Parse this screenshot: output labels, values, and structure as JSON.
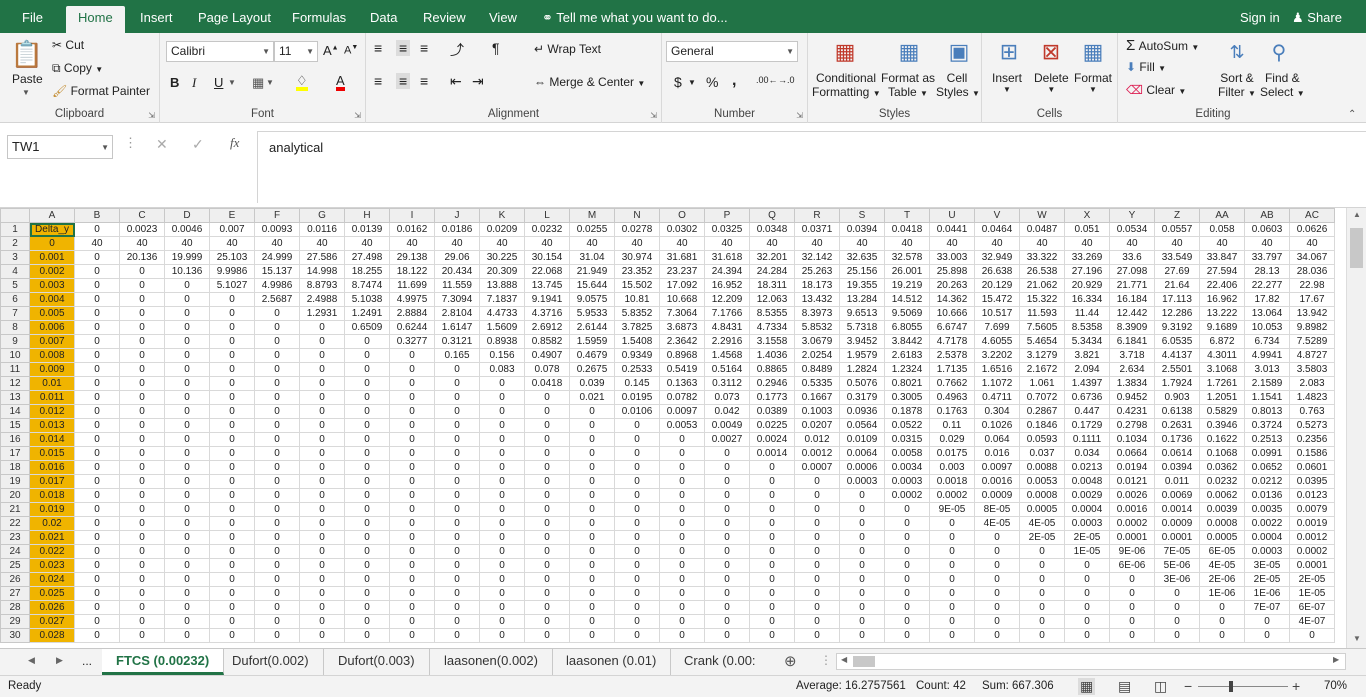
{
  "ribbon_tabs": [
    "File",
    "Home",
    "Insert",
    "Page Layout",
    "Formulas",
    "Data",
    "Review",
    "View"
  ],
  "tell_me": "Tell me what you want to do...",
  "sign_in": "Sign in",
  "share": "Share",
  "clipboard": {
    "paste": "Paste",
    "cut": "Cut",
    "copy": "Copy",
    "format_painter": "Format Painter",
    "label": "Clipboard"
  },
  "font": {
    "name": "Calibri",
    "size": "11",
    "label": "Font",
    "bold": "B",
    "italic": "I",
    "underline": "U"
  },
  "alignment": {
    "wrap_text": "Wrap Text",
    "merge_center": "Merge & Center",
    "label": "Alignment"
  },
  "number": {
    "format": "General",
    "currency": "$",
    "percent": "%",
    "comma": ",",
    "label": "Number"
  },
  "styles": {
    "conditional": "Conditional",
    "formatting": "Formatting",
    "format_as": "Format as",
    "table": "Table",
    "cell": "Cell",
    "cell_styles": "Styles",
    "label": "Styles"
  },
  "cells": {
    "insert": "Insert",
    "delete": "Delete",
    "format": "Format",
    "label": "Cells"
  },
  "editing": {
    "autosum": "AutoSum",
    "fill": "Fill",
    "clear": "Clear",
    "sort": "Sort &",
    "filter": "Filter",
    "find": "Find &",
    "select": "Select",
    "label": "Editing"
  },
  "name_box": "TW1",
  "formula_content": "analytical",
  "fx": "fx",
  "columns": [
    "A",
    "B",
    "C",
    "D",
    "E",
    "F",
    "G",
    "H",
    "I",
    "J",
    "K",
    "L",
    "M",
    "N",
    "O",
    "P",
    "Q",
    "R",
    "S",
    "T",
    "U",
    "V",
    "W",
    "X",
    "Y",
    "Z",
    "AA",
    "AB",
    "AC"
  ],
  "rows": [
    [
      "Delta_y",
      "0",
      "0.0023",
      "0.0046",
      "0.007",
      "0.0093",
      "0.0116",
      "0.0139",
      "0.0162",
      "0.0186",
      "0.0209",
      "0.0232",
      "0.0255",
      "0.0278",
      "0.0302",
      "0.0325",
      "0.0348",
      "0.0371",
      "0.0394",
      "0.0418",
      "0.0441",
      "0.0464",
      "0.0487",
      "0.051",
      "0.0534",
      "0.0557",
      "0.058",
      "0.0603",
      "0.0626"
    ],
    [
      "0",
      "40",
      "40",
      "40",
      "40",
      "40",
      "40",
      "40",
      "40",
      "40",
      "40",
      "40",
      "40",
      "40",
      "40",
      "40",
      "40",
      "40",
      "40",
      "40",
      "40",
      "40",
      "40",
      "40",
      "40",
      "40",
      "40",
      "40",
      "40"
    ],
    [
      "0.001",
      "0",
      "20.136",
      "19.999",
      "25.103",
      "24.999",
      "27.586",
      "27.498",
      "29.138",
      "29.06",
      "30.225",
      "30.154",
      "31.04",
      "30.974",
      "31.681",
      "31.618",
      "32.201",
      "32.142",
      "32.635",
      "32.578",
      "33.003",
      "32.949",
      "33.322",
      "33.269",
      "33.6",
      "33.549",
      "33.847",
      "33.797",
      "34.067"
    ],
    [
      "0.002",
      "0",
      "0",
      "10.136",
      "9.9986",
      "15.137",
      "14.998",
      "18.255",
      "18.122",
      "20.434",
      "20.309",
      "22.068",
      "21.949",
      "23.352",
      "23.237",
      "24.394",
      "24.284",
      "25.263",
      "25.156",
      "26.001",
      "25.898",
      "26.638",
      "26.538",
      "27.196",
      "27.098",
      "27.69",
      "27.594",
      "28.13",
      "28.036"
    ],
    [
      "0.003",
      "0",
      "0",
      "0",
      "5.1027",
      "4.9986",
      "8.8793",
      "8.7474",
      "11.699",
      "11.559",
      "13.888",
      "13.745",
      "15.644",
      "15.502",
      "17.092",
      "16.952",
      "18.311",
      "18.173",
      "19.355",
      "19.219",
      "20.263",
      "20.129",
      "21.062",
      "20.929",
      "21.771",
      "21.64",
      "22.406",
      "22.277",
      "22.98"
    ],
    [
      "0.004",
      "0",
      "0",
      "0",
      "0",
      "2.5687",
      "2.4988",
      "5.1038",
      "4.9975",
      "7.3094",
      "7.1837",
      "9.1941",
      "9.0575",
      "10.81",
      "10.668",
      "12.209",
      "12.063",
      "13.432",
      "13.284",
      "14.512",
      "14.362",
      "15.472",
      "15.322",
      "16.334",
      "16.184",
      "17.113",
      "16.962",
      "17.82",
      "17.67"
    ],
    [
      "0.005",
      "0",
      "0",
      "0",
      "0",
      "0",
      "1.2931",
      "1.2491",
      "2.8884",
      "2.8104",
      "4.4733",
      "4.3716",
      "5.9533",
      "5.8352",
      "7.3064",
      "7.1766",
      "8.5355",
      "8.3973",
      "9.6513",
      "9.5069",
      "10.666",
      "10.517",
      "11.593",
      "11.44",
      "12.442",
      "12.286",
      "13.222",
      "13.064",
      "13.942"
    ],
    [
      "0.006",
      "0",
      "0",
      "0",
      "0",
      "0",
      "0",
      "0.6509",
      "0.6244",
      "1.6147",
      "1.5609",
      "2.6912",
      "2.6144",
      "3.7825",
      "3.6873",
      "4.8431",
      "4.7334",
      "5.8532",
      "5.7318",
      "6.8055",
      "6.6747",
      "7.699",
      "7.5605",
      "8.5358",
      "8.3909",
      "9.3192",
      "9.1689",
      "10.053",
      "9.8982"
    ],
    [
      "0.007",
      "0",
      "0",
      "0",
      "0",
      "0",
      "0",
      "0",
      "0.3277",
      "0.3121",
      "0.8938",
      "0.8582",
      "1.5959",
      "1.5408",
      "2.3642",
      "2.2916",
      "3.1558",
      "3.0679",
      "3.9452",
      "3.8442",
      "4.7178",
      "4.6055",
      "5.4654",
      "5.3434",
      "6.1841",
      "6.0535",
      "6.872",
      "6.734",
      "7.5289"
    ],
    [
      "0.008",
      "0",
      "0",
      "0",
      "0",
      "0",
      "0",
      "0",
      "0",
      "0.165",
      "0.156",
      "0.4907",
      "0.4679",
      "0.9349",
      "0.8968",
      "1.4568",
      "1.4036",
      "2.0254",
      "1.9579",
      "2.6183",
      "2.5378",
      "3.2202",
      "3.1279",
      "3.821",
      "3.718",
      "4.4137",
      "4.3011",
      "4.9941",
      "4.8727"
    ],
    [
      "0.009",
      "0",
      "0",
      "0",
      "0",
      "0",
      "0",
      "0",
      "0",
      "0",
      "0.083",
      "0.078",
      "0.2675",
      "0.2533",
      "0.5419",
      "0.5164",
      "0.8865",
      "0.8489",
      "1.2824",
      "1.2324",
      "1.7135",
      "1.6516",
      "2.1672",
      "2.094",
      "2.634",
      "2.5501",
      "3.1068",
      "3.013",
      "3.5803"
    ],
    [
      "0.01",
      "0",
      "0",
      "0",
      "0",
      "0",
      "0",
      "0",
      "0",
      "0",
      "0",
      "0.0418",
      "0.039",
      "0.145",
      "0.1363",
      "0.3112",
      "0.2946",
      "0.5335",
      "0.5076",
      "0.8021",
      "0.7662",
      "1.1072",
      "1.061",
      "1.4397",
      "1.3834",
      "1.7924",
      "1.7261",
      "2.1589",
      "2.083"
    ],
    [
      "0.011",
      "0",
      "0",
      "0",
      "0",
      "0",
      "0",
      "0",
      "0",
      "0",
      "0",
      "0",
      "0.021",
      "0.0195",
      "0.0782",
      "0.073",
      "0.1773",
      "0.1667",
      "0.3179",
      "0.3005",
      "0.4963",
      "0.4711",
      "0.7072",
      "0.6736",
      "0.9452",
      "0.903",
      "1.2051",
      "1.1541",
      "1.4823"
    ],
    [
      "0.012",
      "0",
      "0",
      "0",
      "0",
      "0",
      "0",
      "0",
      "0",
      "0",
      "0",
      "0",
      "0",
      "0.0106",
      "0.0097",
      "0.042",
      "0.0389",
      "0.1003",
      "0.0936",
      "0.1878",
      "0.1763",
      "0.304",
      "0.2867",
      "0.447",
      "0.4231",
      "0.6138",
      "0.5829",
      "0.8013",
      "0.763"
    ],
    [
      "0.013",
      "0",
      "0",
      "0",
      "0",
      "0",
      "0",
      "0",
      "0",
      "0",
      "0",
      "0",
      "0",
      "0",
      "0.0053",
      "0.0049",
      "0.0225",
      "0.0207",
      "0.0564",
      "0.0522",
      "0.11",
      "0.1026",
      "0.1846",
      "0.1729",
      "0.2798",
      "0.2631",
      "0.3946",
      "0.3724",
      "0.5273"
    ],
    [
      "0.014",
      "0",
      "0",
      "0",
      "0",
      "0",
      "0",
      "0",
      "0",
      "0",
      "0",
      "0",
      "0",
      "0",
      "0",
      "0.0027",
      "0.0024",
      "0.012",
      "0.0109",
      "0.0315",
      "0.029",
      "0.064",
      "0.0593",
      "0.1111",
      "0.1034",
      "0.1736",
      "0.1622",
      "0.2513",
      "0.2356"
    ],
    [
      "0.015",
      "0",
      "0",
      "0",
      "0",
      "0",
      "0",
      "0",
      "0",
      "0",
      "0",
      "0",
      "0",
      "0",
      "0",
      "0",
      "0.0014",
      "0.0012",
      "0.0064",
      "0.0058",
      "0.0175",
      "0.016",
      "0.037",
      "0.034",
      "0.0664",
      "0.0614",
      "0.1068",
      "0.0991",
      "0.1586"
    ],
    [
      "0.016",
      "0",
      "0",
      "0",
      "0",
      "0",
      "0",
      "0",
      "0",
      "0",
      "0",
      "0",
      "0",
      "0",
      "0",
      "0",
      "0",
      "0.0007",
      "0.0006",
      "0.0034",
      "0.003",
      "0.0097",
      "0.0088",
      "0.0213",
      "0.0194",
      "0.0394",
      "0.0362",
      "0.0652",
      "0.0601"
    ],
    [
      "0.017",
      "0",
      "0",
      "0",
      "0",
      "0",
      "0",
      "0",
      "0",
      "0",
      "0",
      "0",
      "0",
      "0",
      "0",
      "0",
      "0",
      "0",
      "0.0003",
      "0.0003",
      "0.0018",
      "0.0016",
      "0.0053",
      "0.0048",
      "0.0121",
      "0.011",
      "0.0232",
      "0.0212",
      "0.0395"
    ],
    [
      "0.018",
      "0",
      "0",
      "0",
      "0",
      "0",
      "0",
      "0",
      "0",
      "0",
      "0",
      "0",
      "0",
      "0",
      "0",
      "0",
      "0",
      "0",
      "0",
      "0.0002",
      "0.0002",
      "0.0009",
      "0.0008",
      "0.0029",
      "0.0026",
      "0.0069",
      "0.0062",
      "0.0136",
      "0.0123"
    ],
    [
      "0.019",
      "0",
      "0",
      "0",
      "0",
      "0",
      "0",
      "0",
      "0",
      "0",
      "0",
      "0",
      "0",
      "0",
      "0",
      "0",
      "0",
      "0",
      "0",
      "0",
      "9E-05",
      "8E-05",
      "0.0005",
      "0.0004",
      "0.0016",
      "0.0014",
      "0.0039",
      "0.0035",
      "0.0079"
    ],
    [
      "0.02",
      "0",
      "0",
      "0",
      "0",
      "0",
      "0",
      "0",
      "0",
      "0",
      "0",
      "0",
      "0",
      "0",
      "0",
      "0",
      "0",
      "0",
      "0",
      "0",
      "0",
      "4E-05",
      "4E-05",
      "0.0003",
      "0.0002",
      "0.0009",
      "0.0008",
      "0.0022",
      "0.0019"
    ],
    [
      "0.021",
      "0",
      "0",
      "0",
      "0",
      "0",
      "0",
      "0",
      "0",
      "0",
      "0",
      "0",
      "0",
      "0",
      "0",
      "0",
      "0",
      "0",
      "0",
      "0",
      "0",
      "0",
      "2E-05",
      "2E-05",
      "0.0001",
      "0.0001",
      "0.0005",
      "0.0004",
      "0.0012"
    ],
    [
      "0.022",
      "0",
      "0",
      "0",
      "0",
      "0",
      "0",
      "0",
      "0",
      "0",
      "0",
      "0",
      "0",
      "0",
      "0",
      "0",
      "0",
      "0",
      "0",
      "0",
      "0",
      "0",
      "0",
      "1E-05",
      "9E-06",
      "7E-05",
      "6E-05",
      "0.0003",
      "0.0002"
    ],
    [
      "0.023",
      "0",
      "0",
      "0",
      "0",
      "0",
      "0",
      "0",
      "0",
      "0",
      "0",
      "0",
      "0",
      "0",
      "0",
      "0",
      "0",
      "0",
      "0",
      "0",
      "0",
      "0",
      "0",
      "0",
      "6E-06",
      "5E-06",
      "4E-05",
      "3E-05",
      "0.0001"
    ],
    [
      "0.024",
      "0",
      "0",
      "0",
      "0",
      "0",
      "0",
      "0",
      "0",
      "0",
      "0",
      "0",
      "0",
      "0",
      "0",
      "0",
      "0",
      "0",
      "0",
      "0",
      "0",
      "0",
      "0",
      "0",
      "0",
      "3E-06",
      "2E-06",
      "2E-05",
      "2E-05"
    ],
    [
      "0.025",
      "0",
      "0",
      "0",
      "0",
      "0",
      "0",
      "0",
      "0",
      "0",
      "0",
      "0",
      "0",
      "0",
      "0",
      "0",
      "0",
      "0",
      "0",
      "0",
      "0",
      "0",
      "0",
      "0",
      "0",
      "0",
      "1E-06",
      "1E-06",
      "1E-05"
    ],
    [
      "0.026",
      "0",
      "0",
      "0",
      "0",
      "0",
      "0",
      "0",
      "0",
      "0",
      "0",
      "0",
      "0",
      "0",
      "0",
      "0",
      "0",
      "0",
      "0",
      "0",
      "0",
      "0",
      "0",
      "0",
      "0",
      "0",
      "0",
      "7E-07",
      "6E-07"
    ],
    [
      "0.027",
      "0",
      "0",
      "0",
      "0",
      "0",
      "0",
      "0",
      "0",
      "0",
      "0",
      "0",
      "0",
      "0",
      "0",
      "0",
      "0",
      "0",
      "0",
      "0",
      "0",
      "0",
      "0",
      "0",
      "0",
      "0",
      "0",
      "0",
      "4E-07"
    ],
    [
      "0.028",
      "0",
      "0",
      "0",
      "0",
      "0",
      "0",
      "0",
      "0",
      "0",
      "0",
      "0",
      "0",
      "0",
      "0",
      "0",
      "0",
      "0",
      "0",
      "0",
      "0",
      "0",
      "0",
      "0",
      "0",
      "0",
      "0",
      "0",
      "0"
    ]
  ],
  "sheet_tabs": [
    "FTCS (0.00232)",
    "Dufort(0.002)",
    "Dufort(0.003)",
    "laasonen(0.002)",
    "laasonen (0.01)",
    "Crank (0.00:"
  ],
  "active_sheet": 0,
  "sheet_more": "...",
  "status": {
    "ready": "Ready",
    "average": "Average: 16.2757561",
    "count": "Count: 42",
    "sum": "Sum: 667.306",
    "zoom": "70%"
  },
  "colors": {
    "accent": "#217346",
    "highlight": "#f0b400"
  }
}
